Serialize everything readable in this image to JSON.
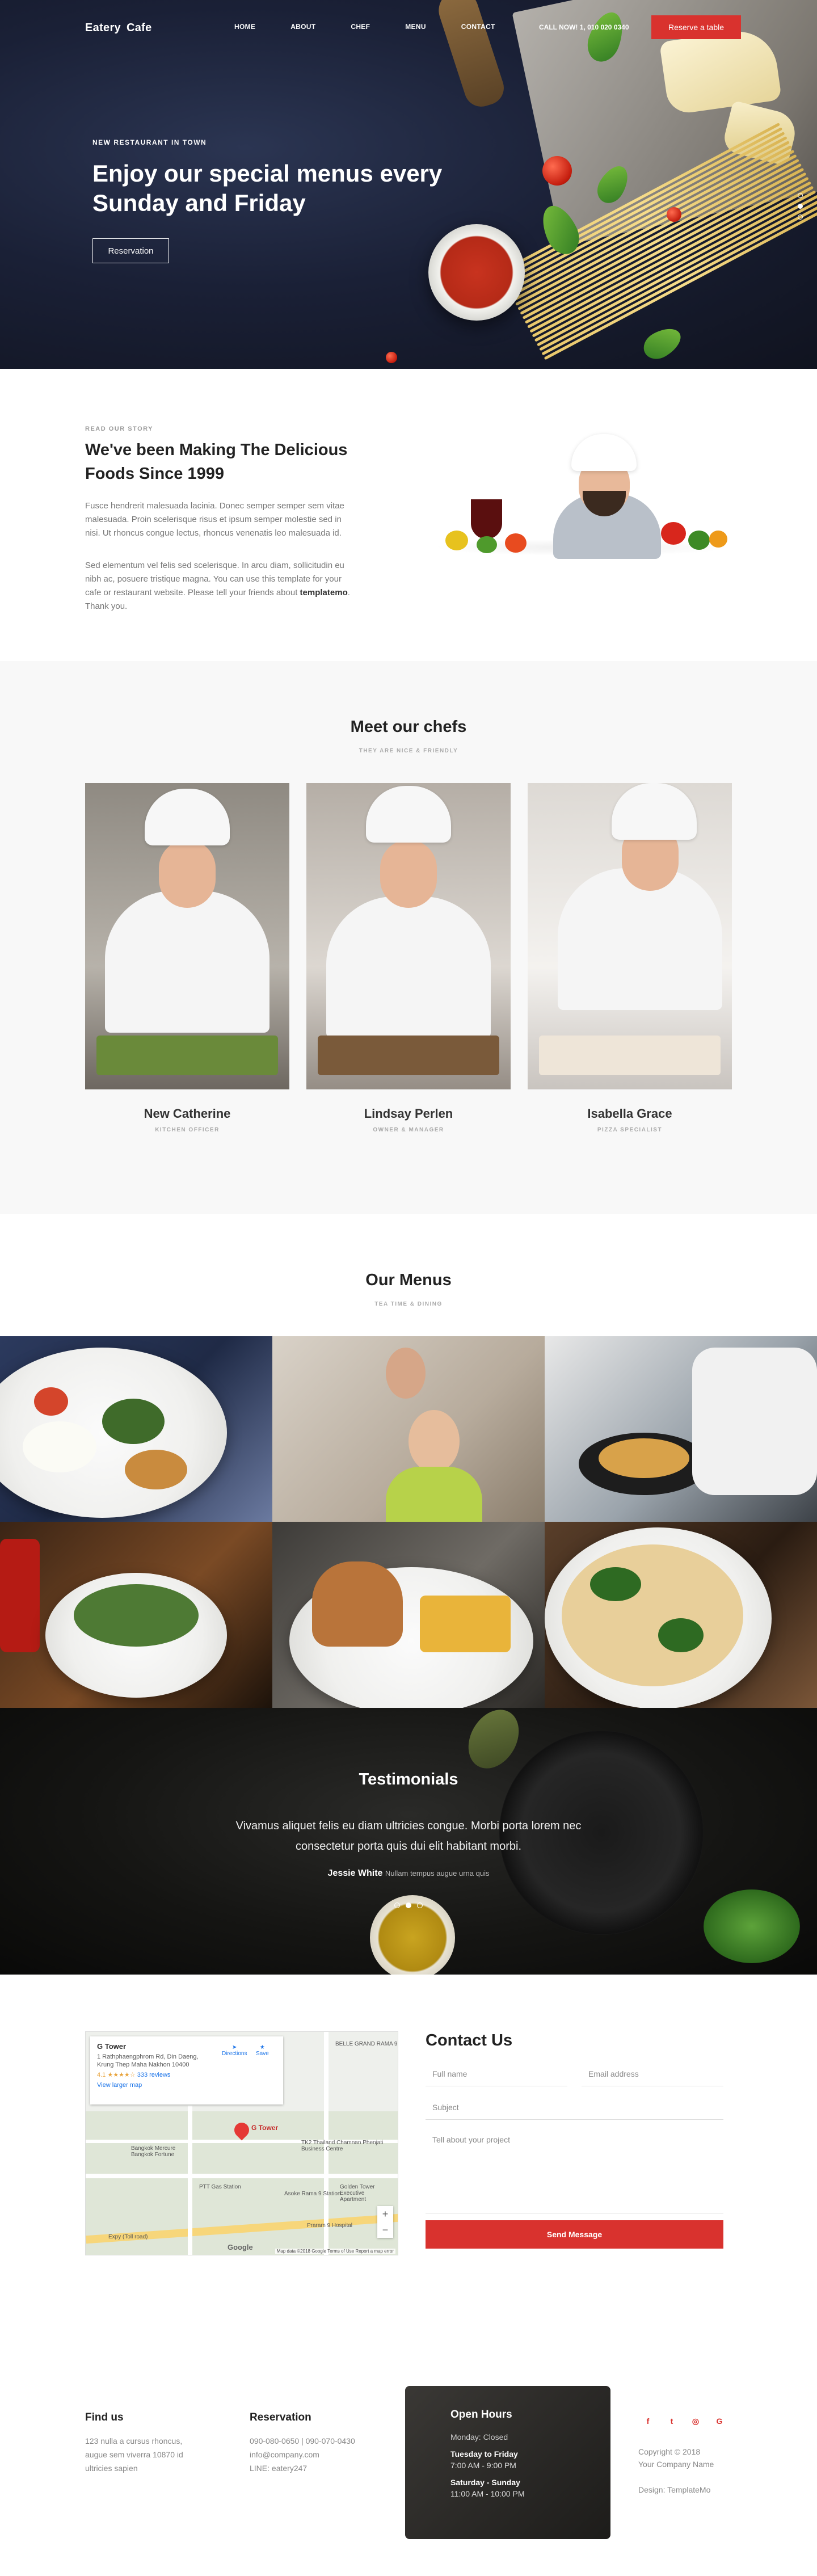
{
  "nav": {
    "brand_left": "Eatery",
    "brand_right": "Cafe",
    "items": [
      "HOME",
      "ABOUT",
      "CHEF",
      "MENU",
      "CONTACT"
    ],
    "call": "CALL NOW! 1, 010 020 0340",
    "reserve": "Reserve a table"
  },
  "hero": {
    "kicker": "NEW RESTAURANT IN TOWN",
    "title": "Enjoy our special menus every Sunday and Friday",
    "button": "Reservation",
    "slides": 3,
    "active_slide": 2
  },
  "about": {
    "kicker": "READ OUR STORY",
    "title": "We've been Making The Delicious Foods Since 1999",
    "p1": "Fusce hendrerit malesuada lacinia. Donec semper semper sem vitae malesuada. Proin scelerisque risus et ipsum semper molestie sed in nisi. Ut rhoncus congue lectus, rhoncus venenatis leo malesuada id.",
    "p2_before": "Sed elementum vel felis sed scelerisque. In arcu diam, sollicitudin eu nibh ac, posuere tristique magna. You can use this template for your cafe or restaurant website. Please tell your friends about ",
    "p2_link": "templatemo",
    "p2_after": ". Thank you."
  },
  "chefs": {
    "title": "Meet our chefs",
    "subtitle": "THEY ARE NICE & FRIENDLY",
    "list": [
      {
        "name": "New Catherine",
        "role": "KITCHEN OFFICER"
      },
      {
        "name": "Lindsay Perlen",
        "role": "OWNER & MANAGER"
      },
      {
        "name": "Isabella Grace",
        "role": "PIZZA SPECIALIST"
      }
    ]
  },
  "menus": {
    "title": "Our Menus",
    "subtitle": "TEA TIME & DINING"
  },
  "testimonials": {
    "title": "Testimonials",
    "quote": "Vivamus aliquet felis eu diam ultricies congue. Morbi porta lorem nec consectetur porta quis dui elit habitant morbi.",
    "author": "Jessie White",
    "author_note": "Nullam tempus augue urna quis",
    "slides": 3,
    "active_slide": 2
  },
  "map": {
    "place": "G Tower",
    "address": "1 Rathphaengphrom Rd, Din Daeng, Krung Thep Maha Nakhon 10400",
    "rating": "4.1 ★★★★☆",
    "reviews": "333 reviews",
    "larger": "View larger map",
    "directions": "Directions",
    "save": "Save",
    "pin_label": "G Tower",
    "labels": [
      "BELLE GRAND RAMA 9",
      "Bangkok Mercure Bangkok Fortune",
      "TK2 Thailand Chamnan Phenjati Business Centre",
      "PTT Gas Station",
      "Asoke Rama 9 Station",
      "Golden Tower Executive Apartment",
      "Expy (Toll road)",
      "Praram 9 Hospital"
    ],
    "google": "Google",
    "attribution": "Map data ©2018 Google  Terms of Use  Report a map error"
  },
  "contact": {
    "title": "Contact Us",
    "name_placeholder": "Full name",
    "email_placeholder": "Email address",
    "subject_placeholder": "Subject",
    "message_placeholder": "Tell about your project",
    "send": "Send Message"
  },
  "footer": {
    "find_title": "Find us",
    "find_text": "123 nulla a cursus rhoncus, augue sem viverra 10870 id ultricies sapien",
    "res_title": "Reservation",
    "res_phone": "090-080-0650 | 090-070-0430",
    "res_email": "info@company.com",
    "res_line": "LINE: eatery247",
    "hours_title": "Open Hours",
    "hours_closed": "Monday: Closed",
    "hours_d1": "Tuesday to Friday",
    "hours_h1": "7:00 AM - 9:00 PM",
    "hours_d2": "Saturday - Sunday",
    "hours_h2": "11:00 AM - 10:00 PM",
    "social": [
      "f",
      "t",
      "◎",
      "G"
    ],
    "copy1": "Copyright © 2018",
    "copy2": "Your Company Name",
    "design": "Design: TemplateMo"
  },
  "colors": {
    "accent": "#d9322e",
    "hero_bg": "#1a2036",
    "footer_hours_bg": "#2a2927"
  },
  "icons": [
    "facebook-icon",
    "twitter-icon",
    "instagram-icon",
    "google-icon",
    "map-pin-icon",
    "directions-icon",
    "save-icon"
  ]
}
